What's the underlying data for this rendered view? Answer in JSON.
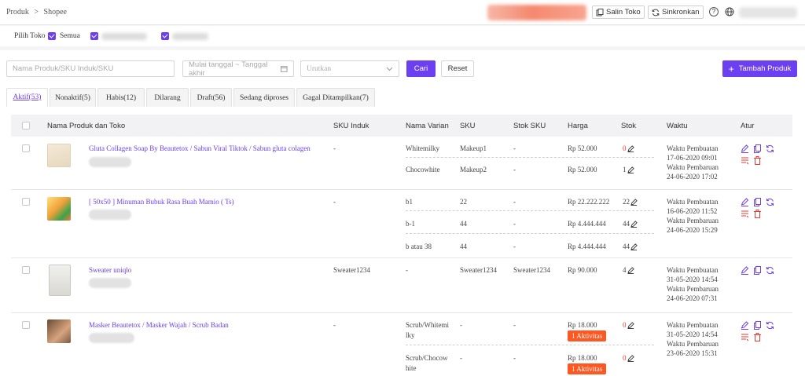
{
  "breadcrumb": {
    "root": "Produk",
    "sep": ">",
    "current": "Shopee"
  },
  "toolbar": {
    "salin": "Salin Toko",
    "sinkron": "Sinkronkan",
    "help": "?"
  },
  "toko": {
    "label": "Pilih Toko",
    "all": "Semua"
  },
  "filters": {
    "search_placeholder": "Nama Produk/SKU Induk/SKU",
    "date_placeholder": "Mulai tanggal ~ Tanggal akhir",
    "sort_placeholder": "Urutkan",
    "cari": "Cari",
    "reset": "Reset",
    "tambah": "Tambah Produk"
  },
  "tabs": [
    "Aktif(53)",
    "Nonaktif(5)",
    "Habis(12)",
    "Dilarang",
    "Draft(56)",
    "Sedang diproses",
    "Gagal Ditampilkan(7)"
  ],
  "columns": [
    "Nama Produk dan Toko",
    "SKU Induk",
    "Nama Varian",
    "SKU",
    "Stok SKU",
    "Harga",
    "Stok",
    "Waktu",
    "Atur"
  ],
  "products": [
    {
      "name": "Gluta Collagen Soap By Beautetox / Sabun Viral Tiktok / Sabun gluta colagen",
      "sku_induk": "-",
      "variants": [
        {
          "name": "Whitemilky",
          "sku": "Makeup1",
          "stok_sku": "-",
          "price": "Rp 52.000",
          "stock": "0"
        },
        {
          "name": "Chocowhite",
          "sku": "Makeup2",
          "stok_sku": "-",
          "price": "Rp 52.000",
          "stock": "1"
        }
      ],
      "created_label": "Waktu Pembuatan",
      "created": "17-06-2020 09:01",
      "updated_label": "Waktu Pembaruan",
      "updated": "24-06-2020 17:02"
    },
    {
      "name": "[ 50x50 ] Minuman Bubuk Rasa Buah Mamio ( Ts)",
      "sku_induk": "-",
      "variants": [
        {
          "name": "b1",
          "sku": "22",
          "stok_sku": "-",
          "price": "Rp 22.222.222",
          "stock": "22"
        },
        {
          "name": "b-1",
          "sku": "44",
          "stok_sku": "-",
          "price": "Rp 4.444.444",
          "stock": "44"
        },
        {
          "name": "b atau 38",
          "sku": "44",
          "stok_sku": "-",
          "price": "Rp 4.444.444",
          "stock": "44"
        }
      ],
      "created_label": "Waktu Pembuatan",
      "created": "16-06-2020 11:52",
      "updated_label": "Waktu Pembaruan",
      "updated": "24-06-2020 15:29"
    },
    {
      "name": "Sweater uniqlo",
      "sku_induk": "Sweater1234",
      "variants": [
        {
          "name": "-",
          "sku": "Sweater1234",
          "stok_sku": "Sweater1234",
          "price": "Rp 90.000",
          "stock": "4"
        }
      ],
      "created_label": "Waktu Pembuatan",
      "created": "31-05-2020 14:54",
      "updated_label": "Waktu Pembaruan",
      "updated": "24-06-2020 07:31"
    },
    {
      "name": "Masker Beautetox / Masker Wajah / Scrub Badan",
      "sku_induk": "-",
      "variants": [
        {
          "name_l1": "Scrub/Whitemi",
          "name_l2": "lky",
          "sku": "-",
          "stok_sku": "-",
          "price": "Rp 18.000",
          "badge": "1 Aktivitas",
          "stock": "0"
        },
        {
          "name_l1": "Scrub/Chocow",
          "name_l2": "hite",
          "sku": "-",
          "stok_sku": "-",
          "price": "Rp 18.000",
          "badge": "1 Aktivitas",
          "stock": "0"
        }
      ],
      "created_label": "Waktu Pembuatan",
      "created": "31-05-2020 14:54",
      "updated_label": "Waktu Pembaruan",
      "updated": "23-06-2020 15:31"
    }
  ],
  "colors": {
    "accent": "#6c3ff0",
    "danger": "#e53935",
    "badge": "#ff5722"
  }
}
